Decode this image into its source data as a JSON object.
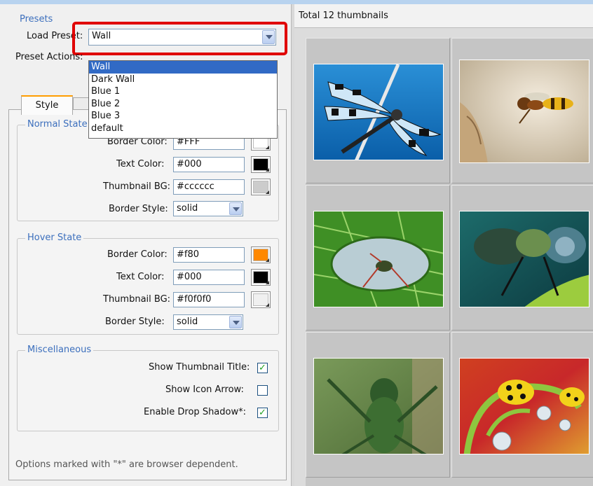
{
  "presets": {
    "group_title": "Presets",
    "load_label": "Load Preset:",
    "load_value": "Wall",
    "actions_label": "Preset Actions:",
    "options": [
      "Wall",
      "Dark Wall",
      "Blue 1",
      "Blue 2",
      "Blue 3",
      "default"
    ]
  },
  "tabs": {
    "style": "Style"
  },
  "normal_state": {
    "title": "Normal State",
    "border_color_label": "Border Color:",
    "border_color": "#FFF",
    "text_color_label": "Text Color:",
    "text_color": "#000",
    "thumb_bg_label": "Thumbnail BG:",
    "thumb_bg": "#cccccc",
    "border_style_label": "Border Style:",
    "border_style": "solid",
    "swatches": {
      "border": "#ffffff",
      "text": "#000000",
      "bg": "#cccccc"
    }
  },
  "hover_state": {
    "title": "Hover State",
    "border_color_label": "Border Color:",
    "border_color": "#f80",
    "text_color_label": "Text Color:",
    "text_color": "#000",
    "thumb_bg_label": "Thumbnail BG:",
    "thumb_bg": "#f0f0f0",
    "border_style_label": "Border Style:",
    "border_style": "solid",
    "swatches": {
      "border": "#ff8800",
      "text": "#000000",
      "bg": "#f0f0f0"
    }
  },
  "misc": {
    "title": "Miscellaneous",
    "show_title_label": "Show Thumbnail Title:",
    "show_title": true,
    "show_arrow_label": "Show Icon Arrow:",
    "show_arrow": false,
    "drop_shadow_label": "Enable Drop Shadow*:",
    "drop_shadow": true
  },
  "footer_note": "Options marked with \"*\" are browser dependent.",
  "gallery": {
    "total_label": "Total 12 thumbnails",
    "thumbs": [
      "dragonfly",
      "wasp",
      "grasshopper-on-leaf",
      "dragonfly-closeup",
      "grasshopper",
      "ladybugs"
    ]
  },
  "colors": {
    "accent_title": "#3c6fbd",
    "highlight_red": "#e00000",
    "selection": "#316ac5"
  }
}
